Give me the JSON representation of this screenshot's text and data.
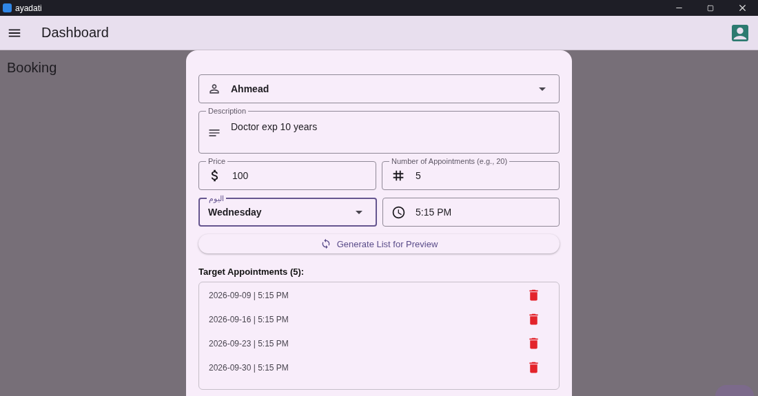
{
  "window": {
    "title": "ayadati"
  },
  "app_bar": {
    "title": "Dashboard"
  },
  "page": {
    "title": "Booking"
  },
  "form": {
    "doctor": {
      "value": "Ahmead"
    },
    "description": {
      "label": "Description",
      "value": "Doctor exp 10 years"
    },
    "price": {
      "label": "Price",
      "value": "100"
    },
    "count": {
      "label": "Number of Appointments (e.g., 20)",
      "value": "5"
    },
    "day": {
      "label": "اليوم",
      "value": "Wednesday",
      "focused": true
    },
    "time": {
      "value": "5:15 PM"
    },
    "generate_button": "Generate List for Preview",
    "list_title": "Target Appointments (5):",
    "appointments": [
      {
        "text": "2026-09-09 | 5:15 PM"
      },
      {
        "text": "2026-09-16 | 5:15 PM"
      },
      {
        "text": "2026-09-23 | 5:15 PM"
      },
      {
        "text": "2026-09-30 | 5:15 PM"
      }
    ]
  }
}
